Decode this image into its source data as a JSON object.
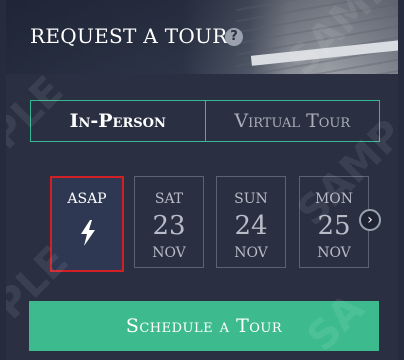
{
  "header": {
    "title": "REQUEST A TOUR",
    "help_icon": "?"
  },
  "tabs": [
    {
      "label": "In-Person",
      "active": true
    },
    {
      "label": "Virtual Tour",
      "active": false
    }
  ],
  "dates": [
    {
      "label": "ASAP",
      "icon": "lightning-bolt-icon",
      "selected": true
    },
    {
      "dow": "SAT",
      "day": "23",
      "month": "NOV"
    },
    {
      "dow": "SUN",
      "day": "24",
      "month": "NOV"
    },
    {
      "dow": "MON",
      "day": "25",
      "month": "NOV"
    }
  ],
  "next_icon": "›",
  "cta_label": "Schedule a Tour",
  "colors": {
    "accent": "#3dbb8f",
    "selected_border": "#d21f26",
    "background": "#2a3042"
  }
}
